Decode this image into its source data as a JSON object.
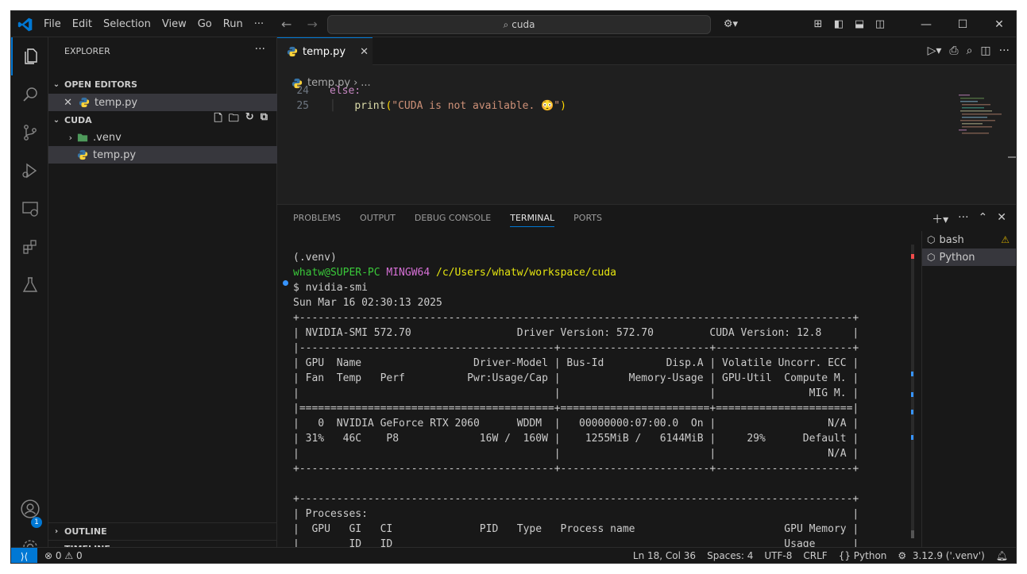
{
  "titlebar": {
    "menu": [
      "File",
      "Edit",
      "Selection",
      "View",
      "Go",
      "Run",
      "···"
    ],
    "search": "cuda"
  },
  "sidebar": {
    "title": "EXPLORER",
    "more": "···",
    "open_editors_label": "OPEN EDITORS",
    "open_editor_file": "temp.py",
    "folder_label": "CUDA",
    "tree": [
      ".venv",
      "temp.py"
    ],
    "outline_label": "OUTLINE",
    "timeline_label": "TIMELINE"
  },
  "accounts_badge": "1",
  "editor": {
    "tab_label": "temp.py",
    "breadcrumb_file": "temp.py",
    "breadcrumb_more": "...",
    "lines": [
      {
        "num": "24",
        "text": "else:"
      },
      {
        "num": "25",
        "text": "    print(\"CUDA is not available. 😳\")"
      }
    ]
  },
  "panel": {
    "tabs": [
      "PROBLEMS",
      "OUTPUT",
      "DEBUG CONSOLE",
      "TERMINAL",
      "PORTS"
    ],
    "active_tab": "TERMINAL",
    "terminals": [
      "bash",
      "Python"
    ],
    "terminal_lines": [
      "(.venv)",
      "__PROMPT__",
      "$ nvidia-smi",
      "Sun Mar 16 02:30:13 2025",
      "+-----------------------------------------------------------------------------------------+",
      "| NVIDIA-SMI 572.70                 Driver Version: 572.70         CUDA Version: 12.8     |",
      "|-----------------------------------------+------------------------+----------------------+",
      "| GPU  Name                  Driver-Model | Bus-Id          Disp.A | Volatile Uncorr. ECC |",
      "| Fan  Temp   Perf          Pwr:Usage/Cap |           Memory-Usage | GPU-Util  Compute M. |",
      "|                                         |                        |               MIG M. |",
      "|=========================================+========================+======================|",
      "|   0  NVIDIA GeForce RTX 2060      WDDM  |   00000000:07:00.0  On |                  N/A |",
      "| 31%   46C    P8             16W /  160W |    1255MiB /   6144MiB |     29%      Default |",
      "|                                         |                        |                  N/A |",
      "+-----------------------------------------+------------------------+----------------------+",
      "",
      "+-----------------------------------------------------------------------------------------+",
      "| Processes:                                                                              |",
      "|  GPU   GI   CI              PID   Type   Process name                        GPU Memory |",
      "|        ID   ID                                                               Usage      |"
    ],
    "prompt": {
      "user": "whatw@SUPER-PC",
      "shell": "MINGW64",
      "path": "/c/Users/whatw/workspace/cuda"
    }
  },
  "statusbar": {
    "errors": "0",
    "warnings": "0",
    "position": "Ln 18, Col 36",
    "spaces": "Spaces: 4",
    "encoding": "UTF-8",
    "eol": "CRLF",
    "language": "Python",
    "interpreter": "3.12.9 ('.venv')"
  },
  "colors": {
    "accent": "#0078d4",
    "prompt_user": "#3ac93a",
    "prompt_shell": "#d670d6",
    "prompt_path": "#e5e510"
  }
}
